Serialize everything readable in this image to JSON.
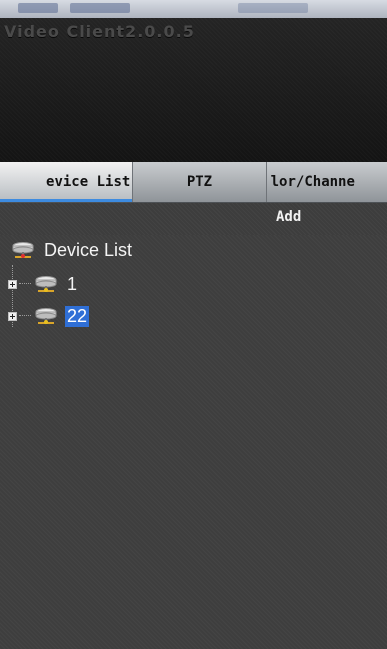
{
  "window": {
    "title": "Video Client2.0.0.5"
  },
  "tabs": [
    {
      "label": "Device List",
      "visible_text": "evice List",
      "active": true
    },
    {
      "label": "PTZ",
      "active": false
    },
    {
      "label": "Color/Channel",
      "visible_text": "lor/Channe",
      "active": false
    }
  ],
  "toolbar": {
    "add_label": "Add"
  },
  "tree": {
    "root": {
      "label": "Device List",
      "icon": "network-device-icon"
    },
    "children": [
      {
        "label": "1",
        "icon": "network-device-icon",
        "selected": false
      },
      {
        "label": "22",
        "icon": "network-device-icon",
        "selected": true
      }
    ]
  },
  "colors": {
    "selection": "#2f6fd6",
    "active_tab_accent": "#3d8be0"
  }
}
